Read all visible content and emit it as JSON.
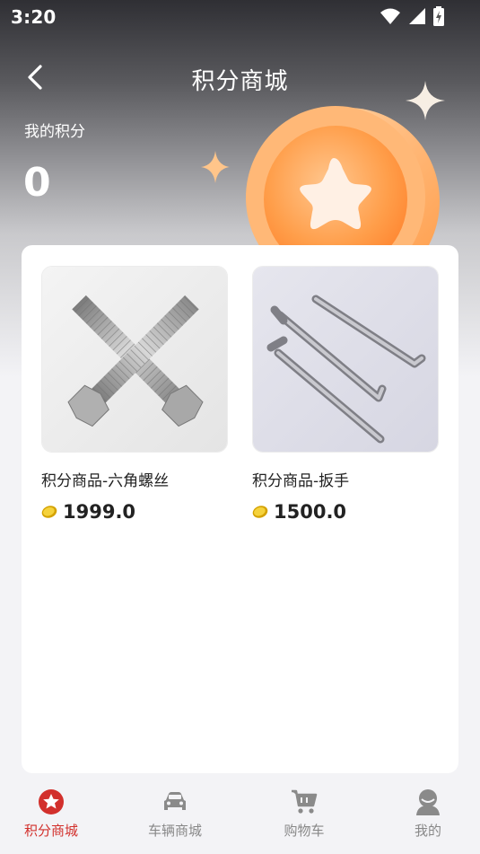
{
  "status_bar": {
    "time": "3:20"
  },
  "header": {
    "title": "积分商城"
  },
  "points": {
    "label": "我的积分",
    "value": "0"
  },
  "products": [
    {
      "name": "积分商品-六角螺丝",
      "price": "1999.0"
    },
    {
      "name": "积分商品-扳手",
      "price": "1500.0"
    }
  ],
  "bottom_nav": [
    {
      "label": "积分商城",
      "icon": "star-badge-icon",
      "active": true
    },
    {
      "label": "车辆商城",
      "icon": "car-icon",
      "active": false
    },
    {
      "label": "购物车",
      "icon": "cart-icon",
      "active": false
    },
    {
      "label": "我的",
      "icon": "user-icon",
      "active": false
    }
  ],
  "colors": {
    "accent": "#d2302c",
    "coin": "#ffa04a",
    "inactive": "#888888"
  }
}
